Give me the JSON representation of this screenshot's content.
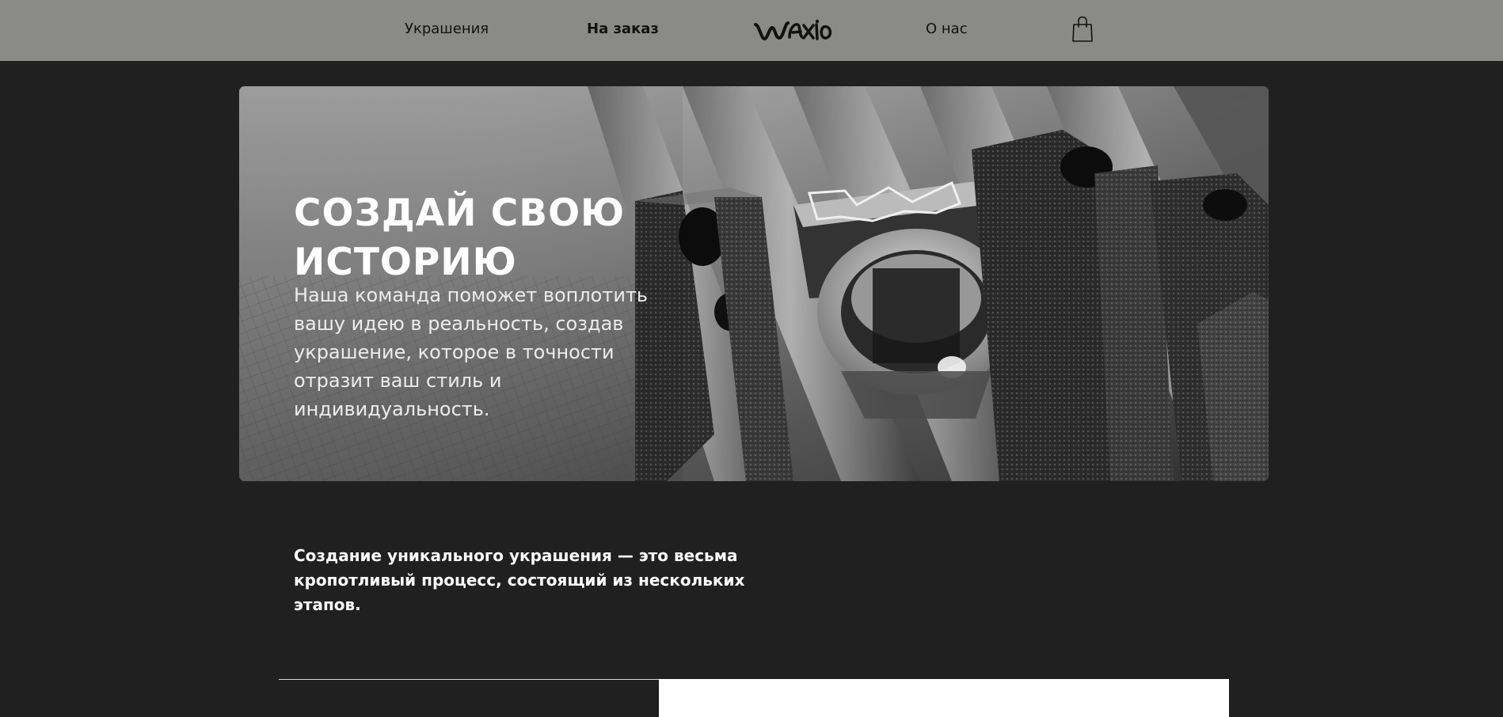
{
  "nav": {
    "jewelry": "Украшения",
    "custom": "На заказ",
    "about": "О нас",
    "logo_icon": "brand-logo-graffiti",
    "cart_icon": "shopping-bag-icon"
  },
  "hero": {
    "title": "СОЗДАЙ СВОЮ ИСТОРИЮ",
    "text": "Наша команда поможет воплотить вашу идею в реальность, создав украшение, которое в точности отразит ваш стиль и индивидуальность."
  },
  "process": {
    "intro": "Создание уникального украшения — это весьма кропотливый процесс, состоящий из нескольких этапов."
  },
  "colors": {
    "navbar_bg": "#8a8a88",
    "page_bg": "#202020",
    "text_light": "#ffffff"
  }
}
